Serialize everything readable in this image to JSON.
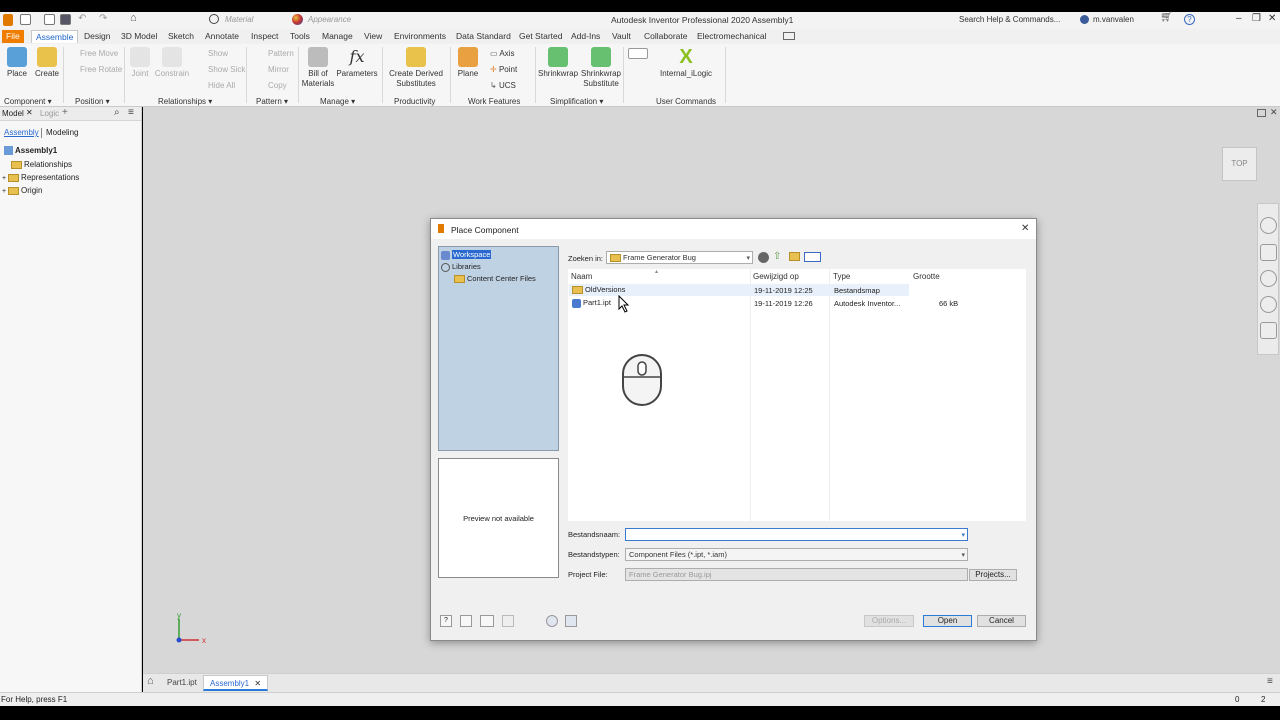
{
  "app": {
    "title": "Autodesk Inventor Professional 2020   Assembly1",
    "material_placeholder": "Material",
    "appearance_placeholder": "Appearance",
    "search_placeholder": "Search Help & Commands...",
    "user": "m.vanvalen"
  },
  "ribbon_tabs": [
    "File",
    "Assemble",
    "Design",
    "3D Model",
    "Sketch",
    "Annotate",
    "Inspect",
    "Tools",
    "Manage",
    "View",
    "Environments",
    "Data Standard",
    "Get Started",
    "Add-Ins",
    "Vault",
    "Collaborate",
    "Electromechanical"
  ],
  "ribbon": {
    "place": "Place",
    "create": "Create",
    "free_move": "Free Move",
    "free_rotate": "Free Rotate",
    "joint": "Joint",
    "constrain": "Constrain",
    "show": "Show",
    "show_sick": "Show Sick",
    "hide_all": "Hide All",
    "pattern": "Pattern",
    "mirror": "Mirror",
    "copy": "Copy",
    "bom_line1": "Bill of",
    "bom_line2": "Materials",
    "parameters": "Parameters",
    "cds_line1": "Create Derived",
    "cds_line2": "Substitutes",
    "plane": "Plane",
    "axis": "Axis",
    "point": "Point",
    "ucs": "UCS",
    "shrinkwrap": "Shrinkwrap",
    "shrinkwrap_sub_line1": "Shrinkwrap",
    "shrinkwrap_sub_line2": "Substitute",
    "ilogic": "Internal_iLogic",
    "panels": {
      "component": "Component ▾",
      "position": "Position ▾",
      "relationships": "Relationships ▾",
      "pattern": "Pattern ▾",
      "manage": "Manage ▾",
      "productivity": "Productivity",
      "work_features": "Work Features",
      "simplification": "Simplification ▾",
      "user_commands": "User Commands"
    }
  },
  "browser": {
    "tab_model": "Model",
    "tab_logic": "Logic",
    "sub_assembly": "Assembly",
    "sub_modeling": "Modeling",
    "root": "Assembly1",
    "items": [
      "Relationships",
      "Representations",
      "Origin"
    ]
  },
  "viewcube": "TOP",
  "axis_x": "x",
  "axis_y": "y",
  "doc_tabs": [
    "Part1.ipt",
    "Assembly1"
  ],
  "status": {
    "help": "For Help, press F1",
    "count1": "0",
    "count2": "2"
  },
  "dialog": {
    "title": "Place Component",
    "locations": [
      "Workspace",
      "Libraries",
      "Content Center Files"
    ],
    "preview": "Preview not available",
    "look_in_label": "Zoeken in:",
    "look_in_value": "Frame Generator Bug",
    "columns": [
      "Naam",
      "Gewijzigd op",
      "Type",
      "Grootte"
    ],
    "files": [
      {
        "name": "OldVersions",
        "date": "19-11-2019 12:25",
        "type": "Bestandsmap",
        "size": ""
      },
      {
        "name": "Part1.ipt",
        "date": "19-11-2019 12:26",
        "type": "Autodesk Inventor...",
        "size": "66 kB"
      }
    ],
    "filename_label": "Bestandsnaam:",
    "filename_value": "",
    "filetype_label": "Bestandstypen:",
    "filetype_value": "Component Files (*.ipt, *.iam)",
    "project_label": "Project File:",
    "project_value": "Frame Generator Bug.ipj",
    "projects_btn": "Projects...",
    "options_btn": "Options...",
    "open_btn": "Open",
    "cancel_btn": "Cancel"
  }
}
